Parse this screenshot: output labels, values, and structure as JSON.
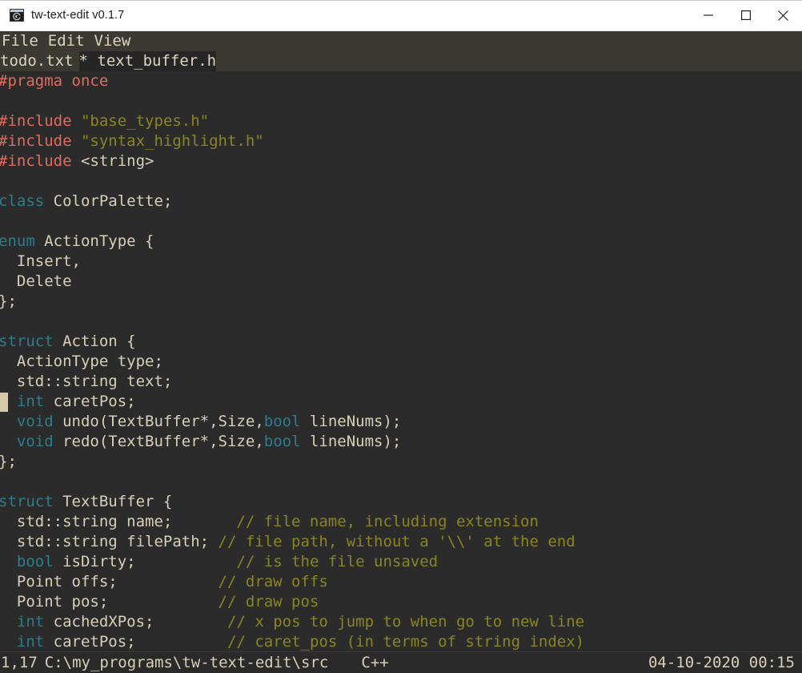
{
  "window": {
    "title": "tw-text-edit v0.1.7",
    "icon": "app-window-icon",
    "controls": {
      "minimize": "minimize-icon",
      "maximize": "maximize-icon",
      "close": "close-icon"
    }
  },
  "menu": {
    "items": [
      "File",
      "Edit",
      "View"
    ]
  },
  "tabs": [
    {
      "label": "todo.txt",
      "active": false,
      "modified": false
    },
    {
      "label": "* text_buffer.h",
      "active": true,
      "modified": true
    }
  ],
  "editor": {
    "caret": {
      "line": 1,
      "column": 17
    },
    "lines": [
      [
        {
          "t": "#pragma once",
          "c": "pp"
        }
      ],
      [
        {
          "t": "",
          "c": "default"
        }
      ],
      [
        {
          "t": "#include ",
          "c": "pp"
        },
        {
          "t": "\"base_types.h\"",
          "c": "str"
        }
      ],
      [
        {
          "t": "#include ",
          "c": "pp"
        },
        {
          "t": "\"syntax_highlight.h\"",
          "c": "str"
        }
      ],
      [
        {
          "t": "#include ",
          "c": "pp"
        },
        {
          "t": "<string>",
          "c": "default"
        }
      ],
      [
        {
          "t": "",
          "c": "default"
        }
      ],
      [
        {
          "t": "class",
          "c": "kw"
        },
        {
          "t": " ColorPalette;",
          "c": "default"
        }
      ],
      [
        {
          "t": "",
          "c": "default"
        }
      ],
      [
        {
          "t": "enum",
          "c": "kw"
        },
        {
          "t": " ActionType {",
          "c": "default"
        }
      ],
      [
        {
          "t": "  Insert,",
          "c": "default"
        }
      ],
      [
        {
          "t": "  Delete",
          "c": "default"
        }
      ],
      [
        {
          "t": "};",
          "c": "default"
        }
      ],
      [
        {
          "t": "",
          "c": "default"
        }
      ],
      [
        {
          "t": "struct",
          "c": "kw"
        },
        {
          "t": " Action {",
          "c": "default"
        }
      ],
      [
        {
          "t": "  ActionType type;",
          "c": "default"
        }
      ],
      [
        {
          "t": "  std::string text;",
          "c": "default"
        }
      ],
      [
        {
          "t": "  ",
          "c": "default"
        },
        {
          "t": "int",
          "c": "kw"
        },
        {
          "t": " caretPos;",
          "c": "default"
        }
      ],
      [
        {
          "t": "  ",
          "c": "default"
        },
        {
          "t": "void",
          "c": "kw"
        },
        {
          "t": " undo(TextBuffer*,Size,",
          "c": "default"
        },
        {
          "t": "bool",
          "c": "kw"
        },
        {
          "t": " lineNums);",
          "c": "default"
        }
      ],
      [
        {
          "t": "  ",
          "c": "default"
        },
        {
          "t": "void",
          "c": "kw"
        },
        {
          "t": " redo(TextBuffer*,Size,",
          "c": "default"
        },
        {
          "t": "bool",
          "c": "kw"
        },
        {
          "t": " lineNums);",
          "c": "default"
        }
      ],
      [
        {
          "t": "};",
          "c": "default"
        }
      ],
      [
        {
          "t": "",
          "c": "default"
        }
      ],
      [
        {
          "t": "struct",
          "c": "kw"
        },
        {
          "t": " TextBuffer {",
          "c": "default"
        }
      ],
      [
        {
          "t": "  std::string name;       ",
          "c": "default"
        },
        {
          "t": "// file name, including extension",
          "c": "cmt"
        }
      ],
      [
        {
          "t": "  std::string filePath; ",
          "c": "default"
        },
        {
          "t": "// file path, without a '\\\\' at the end",
          "c": "cmt"
        }
      ],
      [
        {
          "t": "  ",
          "c": "default"
        },
        {
          "t": "bool",
          "c": "kw"
        },
        {
          "t": " isDirty;           ",
          "c": "default"
        },
        {
          "t": "// is the file unsaved",
          "c": "cmt"
        }
      ],
      [
        {
          "t": "  Point offs;           ",
          "c": "default"
        },
        {
          "t": "// draw offs",
          "c": "cmt"
        }
      ],
      [
        {
          "t": "  Point pos;            ",
          "c": "default"
        },
        {
          "t": "// draw pos",
          "c": "cmt"
        }
      ],
      [
        {
          "t": "  ",
          "c": "default"
        },
        {
          "t": "int",
          "c": "kw"
        },
        {
          "t": " cachedXPos;        ",
          "c": "default"
        },
        {
          "t": "// x pos to jump to when go to new line",
          "c": "cmt"
        }
      ],
      [
        {
          "t": "  ",
          "c": "default"
        },
        {
          "t": "int",
          "c": "kw"
        },
        {
          "t": " caretPos;          ",
          "c": "default"
        },
        {
          "t": "// caret_pos (in terms of string index)",
          "c": "cmt"
        }
      ]
    ]
  },
  "status_bar": {
    "position": "1,17",
    "path": "C:\\my_programs\\tw-text-edit\\src",
    "language": "C++",
    "datetime": "04-10-2020 00:15"
  },
  "colors": {
    "editor_bg": "#2b2b2b",
    "chrome_bg": "#3c3832",
    "statusbar_bg": "#2a2a2a",
    "text_default": "#d8cfb8",
    "preprocessor": "#e06c5d",
    "string": "#8a8520",
    "keyword": "#2b7d8c",
    "comment": "#8a8520",
    "caret": "#d5c9a8",
    "titlebar_bg": "#ffffff",
    "titlebar_text": "#1a1a1a"
  }
}
